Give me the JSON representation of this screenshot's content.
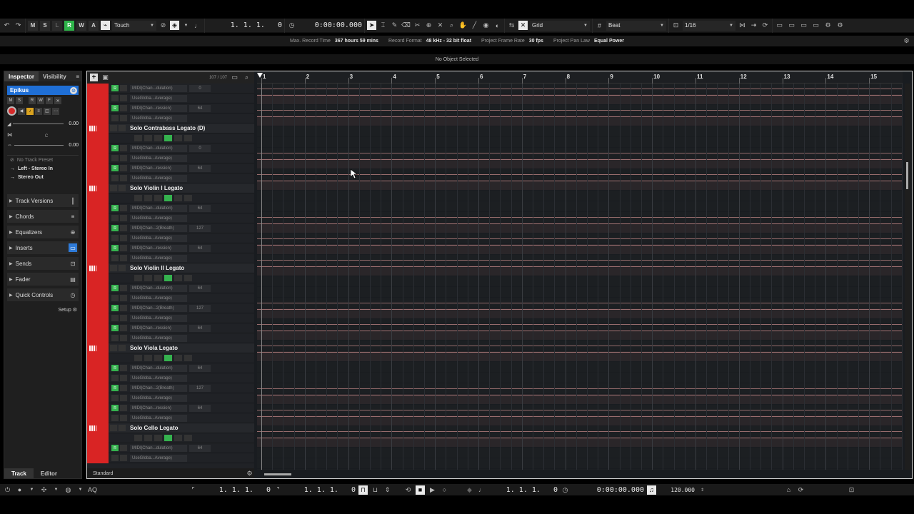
{
  "toolbar": {
    "undo_icon": "undo-icon",
    "m": "M",
    "s": "S",
    "l": "L",
    "r": "R",
    "w": "W",
    "a": "A",
    "automation_mode": "Touch",
    "position": "1. 1. 1.   0",
    "time": "0:00:00.000",
    "snap_type": "Grid",
    "grid_type": "Beat",
    "quantize": "1/16"
  },
  "status": {
    "max_record_time_label": "Max. Record Time",
    "max_record_time": "367 hours 59 mins",
    "record_format_label": "Record Format",
    "record_format": "48 kHz - 32 bit float",
    "frame_rate_label": "Project Frame Rate",
    "frame_rate": "30 fps",
    "pan_law_label": "Project Pan Law",
    "pan_law": "Equal Power",
    "selection": "No Object Selected"
  },
  "inspector": {
    "tab_inspector": "Inspector",
    "tab_visibility": "Visibility",
    "track_name": "Epikus",
    "value1": "0.00",
    "value2": "0.00",
    "c_label": "C",
    "no_preset": "No Track Preset",
    "input": "Left - Stereo In",
    "output": "Stereo Out",
    "sections": [
      "Track Versions",
      "Chords",
      "Equalizers",
      "Inserts",
      "Sends",
      "Fader",
      "Quick Controls"
    ],
    "setup": "Setup",
    "tab_track": "Track",
    "tab_editor": "Editor"
  },
  "tracklist": {
    "count": "107 / 107",
    "footer": "Standard",
    "rows": [
      {
        "type": "lane",
        "name": "MIDI|Chan...dulation)",
        "value": "0"
      },
      {
        "type": "lane2",
        "name": "UseGloba...Average)",
        "value": ""
      },
      {
        "type": "lane",
        "name": "MIDI|Chan...ression)",
        "value": "64"
      },
      {
        "type": "lane2",
        "name": "UseGloba...Average)",
        "value": ""
      },
      {
        "type": "instr",
        "name": "Solo Contrabass Legato (D)"
      },
      {
        "type": "ctrl"
      },
      {
        "type": "lane",
        "name": "MIDI|Chan...dulation)",
        "value": "0"
      },
      {
        "type": "lane2",
        "name": "UseGloba...Average)",
        "value": ""
      },
      {
        "type": "lane",
        "name": "MIDI|Chan...ression)",
        "value": "64"
      },
      {
        "type": "lane2",
        "name": "UseGloba...Average)",
        "value": ""
      },
      {
        "type": "instr",
        "name": "Solo Violin I Legato"
      },
      {
        "type": "ctrl"
      },
      {
        "type": "lane",
        "name": "MIDI|Chan...dulation)",
        "value": "64"
      },
      {
        "type": "lane2",
        "name": "UseGloba...Average)",
        "value": ""
      },
      {
        "type": "lane",
        "name": "MIDI|Chan...2(Breath)",
        "value": "127"
      },
      {
        "type": "lane2",
        "name": "UseGloba...Average)",
        "value": ""
      },
      {
        "type": "lane",
        "name": "MIDI|Chan...ression)",
        "value": "64"
      },
      {
        "type": "lane2",
        "name": "UseGloba...Average)",
        "value": ""
      },
      {
        "type": "instr",
        "name": "Solo Violin II Legato"
      },
      {
        "type": "ctrl"
      },
      {
        "type": "lane",
        "name": "MIDI|Chan...dulation)",
        "value": "64"
      },
      {
        "type": "lane2",
        "name": "UseGloba...Average)",
        "value": ""
      },
      {
        "type": "lane",
        "name": "MIDI|Chan...2(Breath)",
        "value": "127"
      },
      {
        "type": "lane2",
        "name": "UseGloba...Average)",
        "value": ""
      },
      {
        "type": "lane",
        "name": "MIDI|Chan...ression)",
        "value": "64"
      },
      {
        "type": "lane2",
        "name": "UseGloba...Average)",
        "value": ""
      },
      {
        "type": "instr",
        "name": "Solo Viola Legato"
      },
      {
        "type": "ctrl"
      },
      {
        "type": "lane",
        "name": "MIDI|Chan...dulation)",
        "value": "64"
      },
      {
        "type": "lane2",
        "name": "UseGloba...Average)",
        "value": ""
      },
      {
        "type": "lane",
        "name": "MIDI|Chan...2(Breath)",
        "value": "127"
      },
      {
        "type": "lane2",
        "name": "UseGloba...Average)",
        "value": ""
      },
      {
        "type": "lane",
        "name": "MIDI|Chan...ression)",
        "value": "64"
      },
      {
        "type": "lane2",
        "name": "UseGloba...Average)",
        "value": ""
      },
      {
        "type": "instr",
        "name": "Solo Cello Legato"
      },
      {
        "type": "ctrl"
      },
      {
        "type": "lane",
        "name": "MIDI|Chan...dulation)",
        "value": "64"
      },
      {
        "type": "lane2",
        "name": "UseGloba...Average)",
        "value": ""
      }
    ]
  },
  "ruler": {
    "bars": [
      "1",
      "2",
      "3",
      "4",
      "5",
      "6",
      "7",
      "8",
      "9",
      "10",
      "11",
      "12",
      "13",
      "14",
      "15"
    ]
  },
  "transport": {
    "left_locator": "1. 1. 1.   0",
    "right_locator": "1. 1. 1.   0",
    "position": "1. 1. 1.   0",
    "time": "0:00:00.000",
    "tempo": "120.000"
  },
  "colors": {
    "track": "#d92424",
    "accent": "#1f6fd6",
    "green": "#35b24e"
  }
}
